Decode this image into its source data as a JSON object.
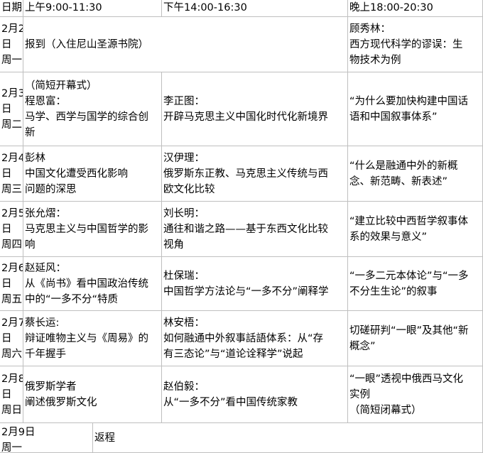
{
  "header": {
    "date": "日期",
    "morning": "上午9:00-11:30",
    "afternoon": "下午14:00-16:30",
    "evening": "晚上18:00-20:30"
  },
  "rows": [
    {
      "date": [
        "2月2",
        "日",
        "周一"
      ],
      "morning": [
        "报到（入住尼山圣源书院）"
      ],
      "evening": [
        "顾秀林：",
        "西方现代科学的谬误：生",
        "物技术为例"
      ]
    },
    {
      "date": [
        "2月3",
        "日",
        "周二"
      ],
      "morning": [
        "（简短开幕式）",
        "程恩富：",
        "马学、西学与国学的综合创",
        "新"
      ],
      "afternoon": [
        "李正图：",
        "开辟马克思主义中国化时代化新境界"
      ],
      "evening": [
        "“为什么要加快构建中国话",
        "语和中国叙事体系”"
      ]
    },
    {
      "date": [
        "2月4",
        "日",
        "周三"
      ],
      "morning": [
        "彭林",
        "中国文化遭受西化影响",
        "问题的深思"
      ],
      "afternoon": [
        "汉伊理：",
        "俄罗斯东正教、马克思主义传统与西",
        "欧文化比较"
      ],
      "evening": [
        "“什么是融通中外的新概",
        "念、新范畴、新表述”"
      ]
    },
    {
      "date": [
        "2月5",
        "日",
        "周四"
      ],
      "morning": [
        "张允熠：",
        "马克思主义与中国哲学的影",
        "响"
      ],
      "afternoon": [
        "刘长明：",
        "通往和谐之路——基于东西文化比较",
        "视角"
      ],
      "evening": [
        "“建立比较中西哲学叙事体",
        "系的效果与意义”"
      ]
    },
    {
      "date": [
        "2月6",
        "日",
        "周五"
      ],
      "morning": [
        "赵延风：",
        "从《尚书》看中国政治传统",
        "中的“一多不分“特质"
      ],
      "afternoon": [
        "杜保瑞：",
        "中国哲学方法论与“一多不分”阐释学"
      ],
      "evening": [
        "“一多二元本体论”与“一多",
        "不分生生论”的叙事"
      ]
    },
    {
      "date": [
        "2月7",
        "日",
        "周六"
      ],
      "morning": [
        "蔡长运:",
        "辩证唯物主义与《周易》的",
        "千年握手"
      ],
      "afternoon": [
        "林安梧：",
        "如何融通中外叙事話語体系：从“存",
        "有三态论”与“道论诠释学”说起"
      ],
      "evening": [
        "切磋研判“一眼”及其他“新",
        "概念”"
      ]
    },
    {
      "date": [
        "2月8",
        "日",
        "周日"
      ],
      "morning": [
        "俄罗斯学者",
        "阐述俄罗斯文化"
      ],
      "afternoon": [
        "赵伯毅：",
        "从“一多不分”看中国传统家教"
      ],
      "evening": [
        "“一眼”透视中俄西马文化",
        "实例",
        "（简短闭幕式）"
      ]
    },
    {
      "date": [
        "2月9日",
        "周一"
      ],
      "morning": [
        "返程"
      ]
    }
  ]
}
